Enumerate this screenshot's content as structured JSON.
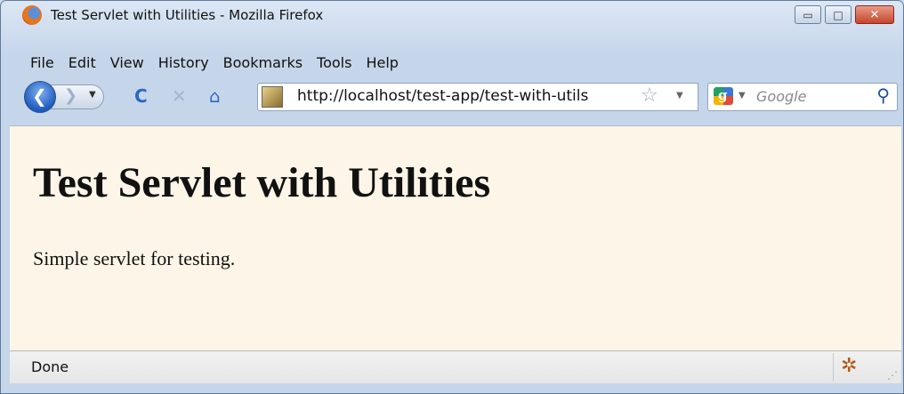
{
  "window": {
    "title": "Test Servlet with Utilities - Mozilla Firefox",
    "controls": {
      "minimize": "▭",
      "maximize": "□",
      "close": "✕"
    }
  },
  "menu": [
    "File",
    "Edit",
    "View",
    "History",
    "Bookmarks",
    "Tools",
    "Help"
  ],
  "toolbar": {
    "back_glyph": "❮",
    "forward_glyph": "❯",
    "dropdown_glyph": "▼",
    "reload_glyph": "C",
    "stop_glyph": "✕",
    "home_glyph": "⌂",
    "url": "http://localhost/test-app/test-with-utils",
    "star_glyph": "☆",
    "search_placeholder": "Google",
    "search_glyph": "⚲",
    "google_letter": "g"
  },
  "page": {
    "heading": "Test Servlet with Utilities",
    "paragraph": "Simple servlet for testing."
  },
  "status": {
    "text": "Done",
    "addon_glyph": "✲",
    "grip_glyph": "⋰"
  },
  "colors": {
    "page_background": "#fdf6e8",
    "chrome": "#cfdcec",
    "link_blue": "#2e67c2"
  }
}
